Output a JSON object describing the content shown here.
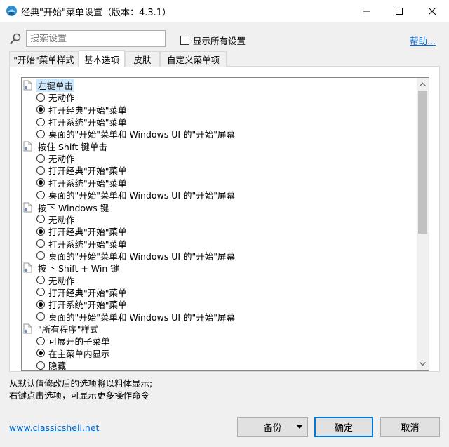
{
  "window": {
    "title": "经典\"开始\"菜单设置（版本：4.3.1）",
    "minimize_glyph": "—",
    "maximize_glyph": "☐",
    "close_glyph": "✕"
  },
  "toolbar": {
    "search_placeholder": "搜索设置",
    "show_all_label": "显示所有设置",
    "show_all_checked": false,
    "help_label": "帮助..."
  },
  "tabs": [
    {
      "label": "\"开始\"菜单样式",
      "active": false
    },
    {
      "label": "基本选项",
      "active": true
    },
    {
      "label": "皮肤",
      "active": false
    },
    {
      "label": "自定义菜单项",
      "active": false
    }
  ],
  "tree": {
    "groups": [
      {
        "label": "左键单击",
        "selected": true,
        "options": [
          {
            "label": "无动作",
            "checked": false
          },
          {
            "label": "打开经典\"开始\"菜单",
            "checked": true
          },
          {
            "label": "打开系统\"开始\"菜单",
            "checked": false
          },
          {
            "label": "桌面的\"开始\"菜单和 Windows UI 的\"开始\"屏幕",
            "checked": false
          }
        ]
      },
      {
        "label": "按住 Shift 键单击",
        "selected": false,
        "options": [
          {
            "label": "无动作",
            "checked": false
          },
          {
            "label": "打开经典\"开始\"菜单",
            "checked": false
          },
          {
            "label": "打开系统\"开始\"菜单",
            "checked": true
          },
          {
            "label": "桌面的\"开始\"菜单和 Windows UI 的\"开始\"屏幕",
            "checked": false
          }
        ]
      },
      {
        "label": "按下 Windows 键",
        "selected": false,
        "options": [
          {
            "label": "无动作",
            "checked": false
          },
          {
            "label": "打开经典\"开始\"菜单",
            "checked": true
          },
          {
            "label": "打开系统\"开始\"菜单",
            "checked": false
          },
          {
            "label": "桌面的\"开始\"菜单和 Windows UI 的\"开始\"屏幕",
            "checked": false
          }
        ]
      },
      {
        "label": "按下 Shift + Win 键",
        "selected": false,
        "options": [
          {
            "label": "无动作",
            "checked": false
          },
          {
            "label": "打开经典\"开始\"菜单",
            "checked": false
          },
          {
            "label": "打开系统\"开始\"菜单",
            "checked": true
          },
          {
            "label": "桌面的\"开始\"菜单和 Windows UI 的\"开始\"屏幕",
            "checked": false
          }
        ]
      },
      {
        "label": "\"所有程序\"样式",
        "selected": false,
        "options": [
          {
            "label": "可展开的子菜单",
            "checked": false
          },
          {
            "label": "在主菜单内显示",
            "checked": true
          },
          {
            "label": "隐藏",
            "checked": false
          }
        ]
      }
    ]
  },
  "notes": {
    "line1": "从默认值修改后的选项将以粗体显示;",
    "line2": "右键点击选项，可显示更多操作命令"
  },
  "footer": {
    "site_link": "www.classicshell.net",
    "backup_label": "备份",
    "ok_label": "确定",
    "cancel_label": "取消"
  },
  "colors": {
    "link": "#0066cc",
    "selection": "#cce8ff",
    "default_button_border": "#0078d7"
  }
}
